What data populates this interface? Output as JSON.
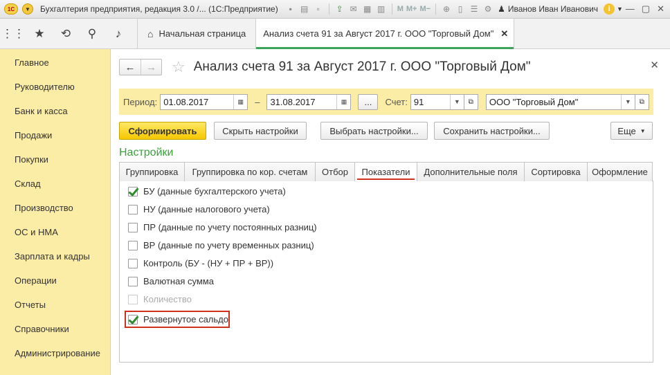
{
  "titlebar": {
    "logo": "1С",
    "title": "Бухгалтерия предприятия, редакция 3.0 /...  (1С:Предприятие)",
    "m_labels": [
      "M",
      "M+",
      "M−"
    ],
    "user": "Иванов Иван Иванович",
    "info": "i"
  },
  "tabs_bar": {
    "home_label": "Начальная страница",
    "doc_label": "Анализ счета 91 за Август 2017 г. ООО \"Торговый Дом\""
  },
  "sidebar": {
    "items": [
      "Главное",
      "Руководителю",
      "Банк и касса",
      "Продажи",
      "Покупки",
      "Склад",
      "Производство",
      "ОС и НМА",
      "Зарплата и кадры",
      "Операции",
      "Отчеты",
      "Справочники",
      "Администрирование"
    ]
  },
  "form": {
    "title": "Анализ счета 91 за Август 2017 г. ООО \"Торговый Дом\"",
    "period_label": "Период:",
    "date_from": "01.08.2017",
    "dash": "–",
    "date_to": "31.08.2017",
    "dots": "...",
    "account_label": "Счет:",
    "account": "91",
    "organization": "ООО \"Торговый Дом\"",
    "btn_generate": "Сформировать",
    "btn_hide": "Скрыть настройки",
    "btn_choose": "Выбрать настройки...",
    "btn_save": "Сохранить настройки...",
    "btn_more": "Еще",
    "settings_title": "Настройки",
    "tabs": [
      "Группировка",
      "Группировка по кор. счетам",
      "Отбор",
      "Показатели",
      "Дополнительные поля",
      "Сортировка",
      "Оформление"
    ],
    "active_tab": "Показатели",
    "indicators": [
      {
        "label": "БУ (данные бухгалтерского учета)",
        "checked": true,
        "disabled": false
      },
      {
        "label": "НУ (данные налогового учета)",
        "checked": false,
        "disabled": false
      },
      {
        "label": "ПР (данные по учету постоянных разниц)",
        "checked": false,
        "disabled": false
      },
      {
        "label": "ВР (данные по учету временных разниц)",
        "checked": false,
        "disabled": false
      },
      {
        "label": "Контроль (БУ - (НУ + ПР + ВР))",
        "checked": false,
        "disabled": false
      },
      {
        "label": "Валютная сумма",
        "checked": false,
        "disabled": false
      },
      {
        "label": "Количество",
        "checked": false,
        "disabled": true
      },
      {
        "label": "Развернутое сальдо",
        "checked": true,
        "disabled": false
      }
    ]
  }
}
